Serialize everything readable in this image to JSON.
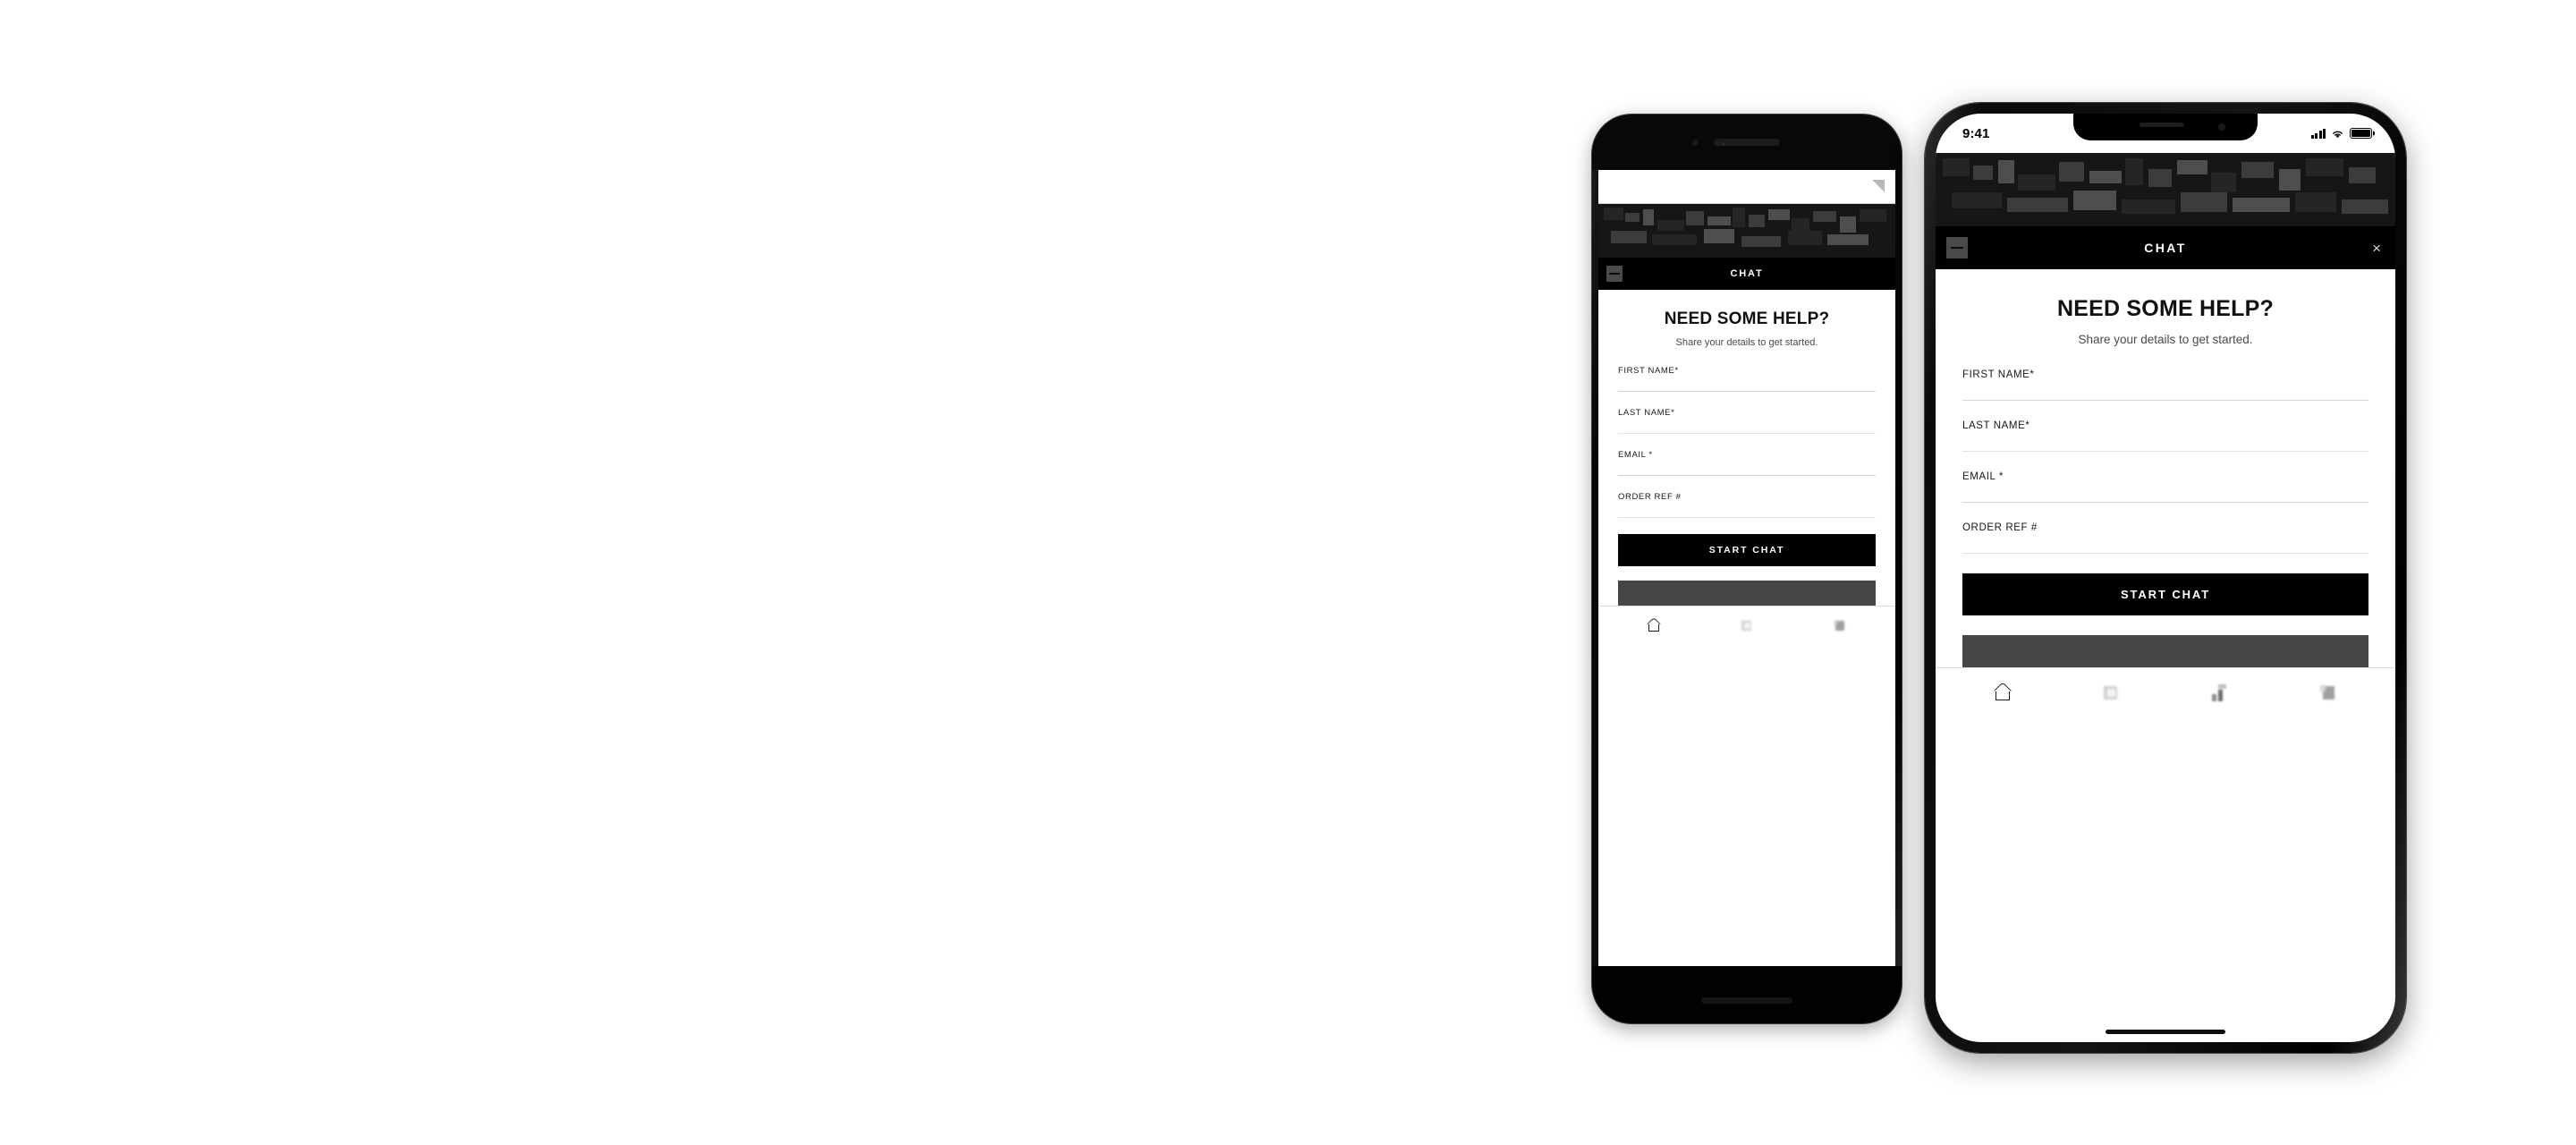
{
  "scene": {
    "description": "Two smartphone mockups showing a CHAT pre-chat form screen",
    "background_color": "#ffffff"
  },
  "phones": [
    {
      "id": "back-phone",
      "style": "bezel",
      "status_bar": {
        "visible": false
      },
      "browser_bar": {
        "icon": "triangle-glyph"
      },
      "brand_banner": {
        "obscured": true,
        "background_color": "#161616"
      },
      "chat_header": {
        "title": "CHAT",
        "menu_icon": "hamburger-icon",
        "close_icon": ""
      },
      "form": {
        "heading": "NEED SOME HELP?",
        "subheading": "Share your details to get started.",
        "fields": [
          {
            "label": "FIRST NAME*",
            "value": "",
            "placeholder": ""
          },
          {
            "label": "LAST NAME*",
            "value": "",
            "placeholder": ""
          },
          {
            "label": "EMAIL *",
            "value": "",
            "placeholder": ""
          },
          {
            "label": "ORDER REF #",
            "value": "",
            "placeholder": ""
          }
        ],
        "submit_label": "START CHAT"
      },
      "bottom_nav": [
        {
          "icon": "home-icon",
          "label": ""
        },
        {
          "icon": "square-icon",
          "label": ""
        },
        {
          "icon": "bag-icon",
          "label": ""
        }
      ]
    },
    {
      "id": "front-phone",
      "style": "notch",
      "status_bar": {
        "visible": true,
        "time": "9:41",
        "signal_icon": "cellular-signal-icon",
        "wifi_icon": "wifi-icon",
        "battery_icon": "battery-icon"
      },
      "brand_banner": {
        "obscured": true,
        "background_color": "#161616"
      },
      "chat_header": {
        "title": "CHAT",
        "menu_icon": "hamburger-icon",
        "close_icon": "×"
      },
      "form": {
        "heading": "NEED SOME HELP?",
        "subheading": "Share your details to get started.",
        "fields": [
          {
            "label": "FIRST NAME*",
            "value": "",
            "placeholder": ""
          },
          {
            "label": "LAST NAME*",
            "value": "",
            "placeholder": ""
          },
          {
            "label": "EMAIL *",
            "value": "",
            "placeholder": ""
          },
          {
            "label": "ORDER REF #",
            "value": "",
            "placeholder": ""
          }
        ],
        "submit_label": "START CHAT"
      },
      "bottom_nav": [
        {
          "icon": "home-icon",
          "label": ""
        },
        {
          "icon": "square-icon",
          "label": ""
        },
        {
          "icon": "bars-icon",
          "label": ""
        },
        {
          "icon": "bag-icon",
          "label": ""
        }
      ]
    }
  ],
  "colors": {
    "accent": "#000000",
    "panel_background": "#ffffff",
    "header_background": "#000000",
    "banner_background": "#161616",
    "grey_strip": "#464646",
    "field_line": "#d4d4d4",
    "device_frame": "#0d0d0d"
  }
}
